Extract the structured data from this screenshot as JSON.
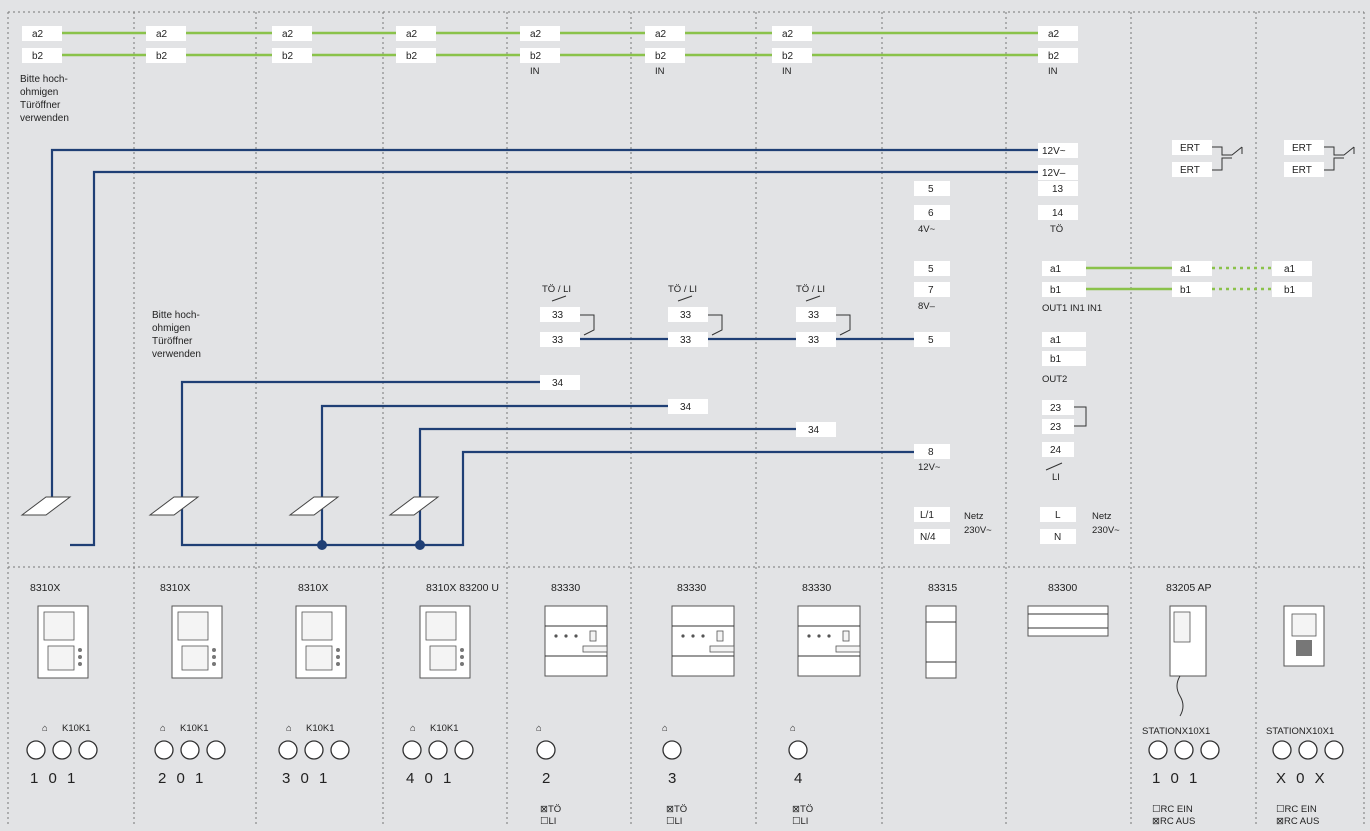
{
  "bus_top": {
    "a": "a2",
    "b": "b2",
    "in_label": "IN"
  },
  "note_text": [
    "Bitte hoch-",
    "ohmigen",
    "Türöffner",
    "verwenden"
  ],
  "power": {
    "v12ac": "12V~",
    "v12dc": "12V–",
    "t13": "13",
    "t14": "14",
    "to": "TÖ",
    "ert": "ERT",
    "t5": "5",
    "t6": "6",
    "v4": "4V~",
    "t7": "7",
    "v8": "8V–",
    "t8": "8",
    "l1": "L/1",
    "n4": "N/4",
    "L": "L",
    "N": "N",
    "netz": "Netz",
    "v230": "230V~"
  },
  "actuator": {
    "header": "TÖ / LI",
    "t33": "33",
    "t34": "34"
  },
  "outputs": {
    "a1": "a1",
    "b1": "b1",
    "out1": "OUT1 IN1 IN1",
    "out2": "OUT2",
    "t23": "23",
    "t24": "24",
    "li": "LI"
  },
  "devices": [
    {
      "title": "8310X",
      "top": "K10K1",
      "code": "1 0 1"
    },
    {
      "title": "8310X",
      "top": "K10K1",
      "code": "2 0 1"
    },
    {
      "title": "8310X",
      "top": "K10K1",
      "code": "3 0 1"
    },
    {
      "title": "8310X 83200 U",
      "top": "K10K1",
      "code": "4 0 1"
    },
    {
      "title": "83330",
      "code": "2",
      "opt1": "⊠TÖ",
      "opt2": "☐LI"
    },
    {
      "title": "83330",
      "code": "3",
      "opt1": "⊠TÖ",
      "opt2": "☐LI"
    },
    {
      "title": "83330",
      "code": "4",
      "opt1": "⊠TÖ",
      "opt2": "☐LI"
    },
    {
      "title": "83315"
    },
    {
      "title": "83300"
    },
    {
      "title": "83205 AP",
      "top": "STATIONX10X1",
      "code": "1 0 1",
      "opt1": "☐RC EIN",
      "opt2": "⊠RC AUS"
    },
    {
      "top": "STATIONX10X1",
      "code": "X 0 X",
      "opt1": "☐RC EIN",
      "opt2": "⊠RC AUS"
    }
  ],
  "colors": {
    "background": "#e2e3e5",
    "bus_green": "#8ac24a",
    "wire_blue": "#1f3f75"
  }
}
